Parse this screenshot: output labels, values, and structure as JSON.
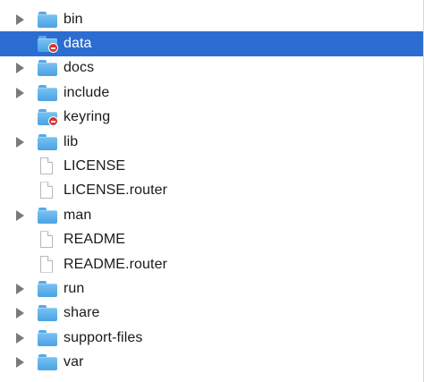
{
  "colors": {
    "selection": "#2c6dd2",
    "folder": "#5aa9e6",
    "badge": "#d9342b"
  },
  "items": [
    {
      "label": "bin",
      "type": "folder",
      "expandable": true,
      "selected": false,
      "badge": false
    },
    {
      "label": "data",
      "type": "folder",
      "expandable": false,
      "selected": true,
      "badge": true
    },
    {
      "label": "docs",
      "type": "folder",
      "expandable": true,
      "selected": false,
      "badge": false
    },
    {
      "label": "include",
      "type": "folder",
      "expandable": true,
      "selected": false,
      "badge": false
    },
    {
      "label": "keyring",
      "type": "folder",
      "expandable": false,
      "selected": false,
      "badge": true
    },
    {
      "label": "lib",
      "type": "folder",
      "expandable": true,
      "selected": false,
      "badge": false
    },
    {
      "label": "LICENSE",
      "type": "file",
      "expandable": false,
      "selected": false,
      "badge": false
    },
    {
      "label": "LICENSE.router",
      "type": "file",
      "expandable": false,
      "selected": false,
      "badge": false
    },
    {
      "label": "man",
      "type": "folder",
      "expandable": true,
      "selected": false,
      "badge": false
    },
    {
      "label": "README",
      "type": "file",
      "expandable": false,
      "selected": false,
      "badge": false
    },
    {
      "label": "README.router",
      "type": "file",
      "expandable": false,
      "selected": false,
      "badge": false
    },
    {
      "label": "run",
      "type": "folder",
      "expandable": true,
      "selected": false,
      "badge": false
    },
    {
      "label": "share",
      "type": "folder",
      "expandable": true,
      "selected": false,
      "badge": false
    },
    {
      "label": "support-files",
      "type": "folder",
      "expandable": true,
      "selected": false,
      "badge": false
    },
    {
      "label": "var",
      "type": "folder",
      "expandable": true,
      "selected": false,
      "badge": false
    }
  ]
}
